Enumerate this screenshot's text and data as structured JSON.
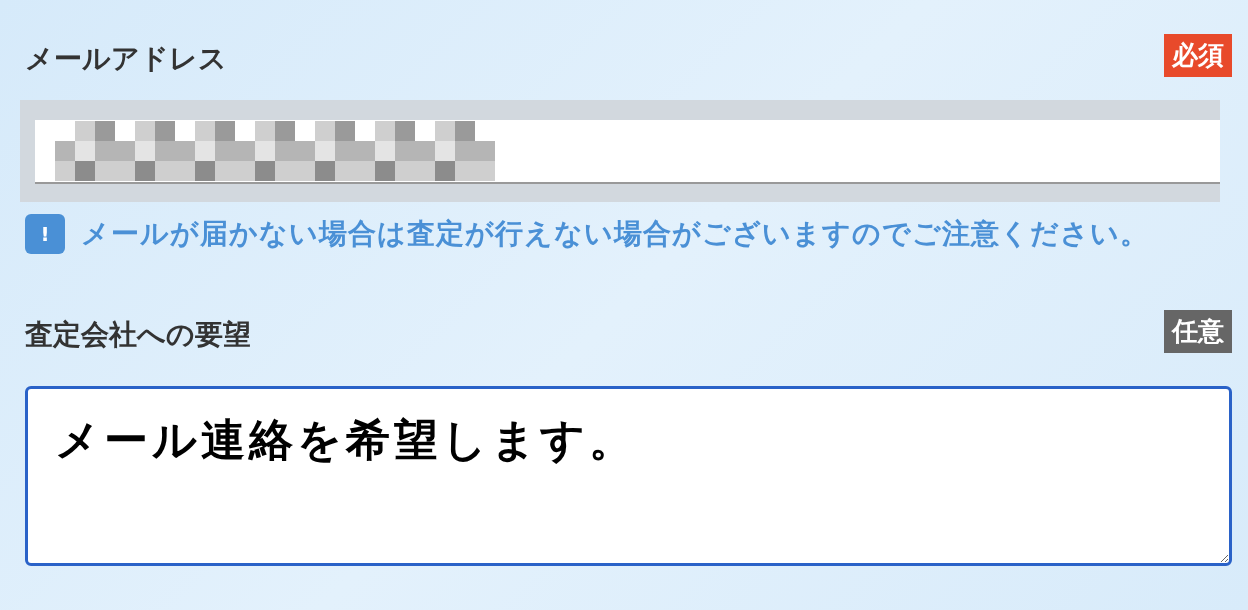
{
  "email": {
    "label": "メールアドレス",
    "badge": {
      "text": "必須",
      "kind": "required"
    },
    "note": {
      "icon": "!",
      "text": "メールが届かない場合は査定が行えない場合がございますのでご注意ください。"
    }
  },
  "request": {
    "label": "査定会社への要望",
    "badge": {
      "text": "任意",
      "kind": "optional"
    },
    "value": "メール連絡を希望します。",
    "focused": true
  }
}
